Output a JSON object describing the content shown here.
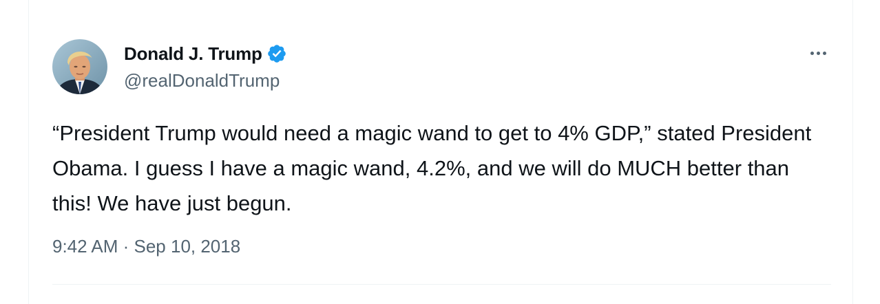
{
  "tweet": {
    "author": {
      "display_name": "Donald J. Trump",
      "handle": "@realDonaldTrump",
      "verified": true,
      "verified_color": "#1d9bf0",
      "avatar_icon": "profile-photo"
    },
    "text": "“President Trump would need a magic wand to get to 4% GDP,” stated President Obama. I guess I have a magic wand, 4.2%, and we will do MUCH better than this! We have just begun.",
    "timestamp": "9:42 AM · Sep 10, 2018",
    "more_icon": "more-options-icon"
  }
}
